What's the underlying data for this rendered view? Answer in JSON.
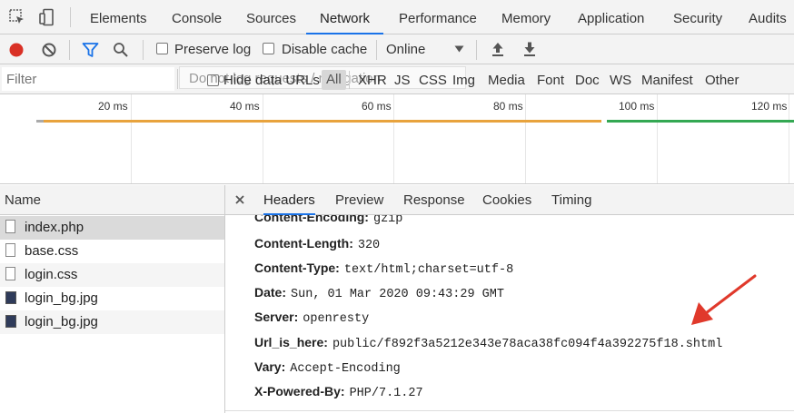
{
  "tabs": {
    "items": [
      "Elements",
      "Console",
      "Sources",
      "Network",
      "Performance",
      "Memory",
      "Application",
      "Security",
      "Audits"
    ],
    "active": "Network"
  },
  "toolbar": {
    "preserve_log": "Preserve log",
    "disable_cache": "Disable cache",
    "throttle": "Online"
  },
  "filterbar": {
    "filter_placeholder": "Filter",
    "tooltip_text": "Do not log requests / navigation",
    "hide_data_urls": "Hide data URLs",
    "all_label": "All",
    "types": [
      "XHR",
      "JS",
      "CSS",
      "Img",
      "Media",
      "Font",
      "Doc",
      "WS",
      "Manifest",
      "Other"
    ]
  },
  "overview": {
    "ticks": [
      "20 ms",
      "40 ms",
      "60 ms",
      "80 ms",
      "100 ms",
      "120 ms"
    ]
  },
  "requests": {
    "header": "Name",
    "items": [
      {
        "name": "index.php",
        "type": "doc",
        "selected": true
      },
      {
        "name": "base.css",
        "type": "doc",
        "selected": false
      },
      {
        "name": "login.css",
        "type": "doc",
        "selected": false
      },
      {
        "name": "login_bg.jpg",
        "type": "img",
        "selected": false
      },
      {
        "name": "login_bg.jpg",
        "type": "img",
        "selected": false
      }
    ]
  },
  "details": {
    "tabs": [
      "Headers",
      "Preview",
      "Response",
      "Cookies",
      "Timing"
    ],
    "active_tab": "Headers",
    "headers": [
      {
        "key": "Content-Encoding:",
        "value": "gzip"
      },
      {
        "key": "Content-Length:",
        "value": "320"
      },
      {
        "key": "Content-Type:",
        "value": "text/html;charset=utf-8"
      },
      {
        "key": "Date:",
        "value": "Sun, 01 Mar 2020 09:43:29 GMT"
      },
      {
        "key": "Server:",
        "value": "openresty"
      },
      {
        "key": "Url_is_here:",
        "value": "public/f892f3a5212e343e78aca38fc094f4a392275f18.shtml"
      },
      {
        "key": "Vary:",
        "value": "Accept-Encoding"
      },
      {
        "key": "X-Powered-By:",
        "value": "PHP/7.1.27"
      }
    ]
  },
  "colors": {
    "accent": "#1a73e8",
    "record": "#d93025",
    "filter_icon": "#1a73e8",
    "waterfall_orange": "#e8a33d",
    "waterfall_green": "#34a853",
    "annotation_arrow": "#e0392b"
  }
}
